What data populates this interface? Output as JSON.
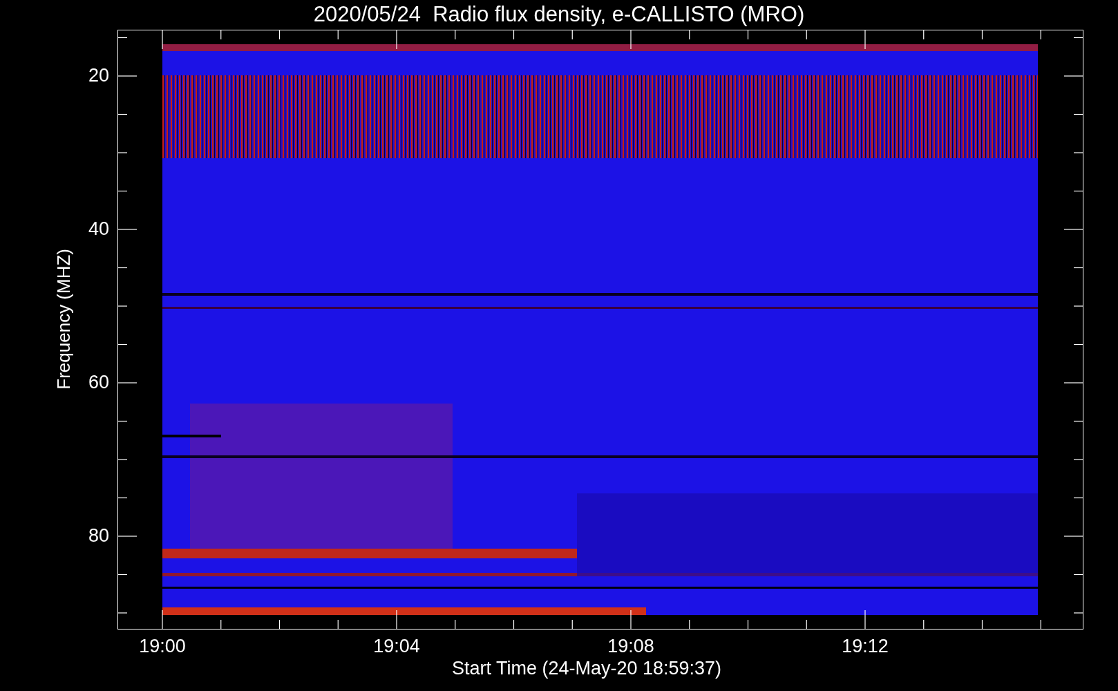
{
  "title": "2020/05/24  Radio flux density, e-CALLISTO (MRO)",
  "y_axis": {
    "label": "Frequency (MHZ)",
    "ticks": [
      "20",
      "40",
      "60",
      "80"
    ]
  },
  "x_axis": {
    "label": "Start Time (24-May-20 18:59:37)",
    "ticks": [
      "19:00",
      "19:04",
      "19:08",
      "19:12"
    ]
  }
}
